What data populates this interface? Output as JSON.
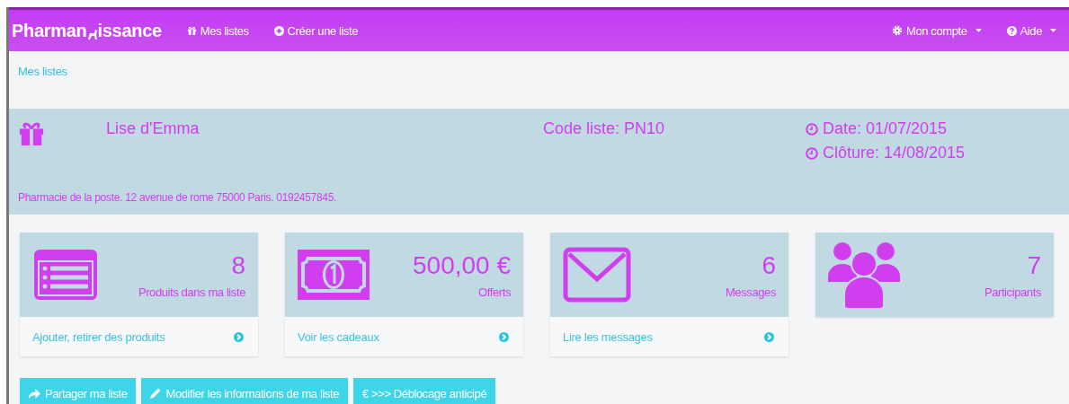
{
  "navbar": {
    "brand": {
      "before": "Pharman",
      "after": "issance"
    },
    "links": [
      {
        "label": "Mes listes"
      },
      {
        "label": "Créer une liste"
      }
    ],
    "right_menus": [
      {
        "label": "Mon compte"
      },
      {
        "label": "Aide"
      }
    ]
  },
  "breadcrumb": "Mes listes",
  "list_info": {
    "name": "Lise d'Emma",
    "code": "Code liste: PN10",
    "date": "Date: 01/07/2015",
    "closing": "Clôture: 14/08/2015",
    "address": "Pharmacie de la poste.  12 avenue de rome 75000 Paris.  0192457845."
  },
  "cards": [
    {
      "kind": "list",
      "value": "8",
      "label": "Produits dans ma liste",
      "link": "Ajouter, retirer des produits"
    },
    {
      "kind": "money",
      "value": "500,00 €",
      "label": "Offerts",
      "link": "Voir les cadeaux"
    },
    {
      "kind": "envelope",
      "value": "6",
      "label": "Messages",
      "link": "Lire les messages"
    },
    {
      "kind": "people",
      "value": "7",
      "label": "Participants"
    }
  ],
  "buttons": [
    {
      "label": "Partager ma liste"
    },
    {
      "label": "Modifier les informations de ma liste"
    },
    {
      "label": "€ >>> Déblocage anticipé"
    }
  ]
}
